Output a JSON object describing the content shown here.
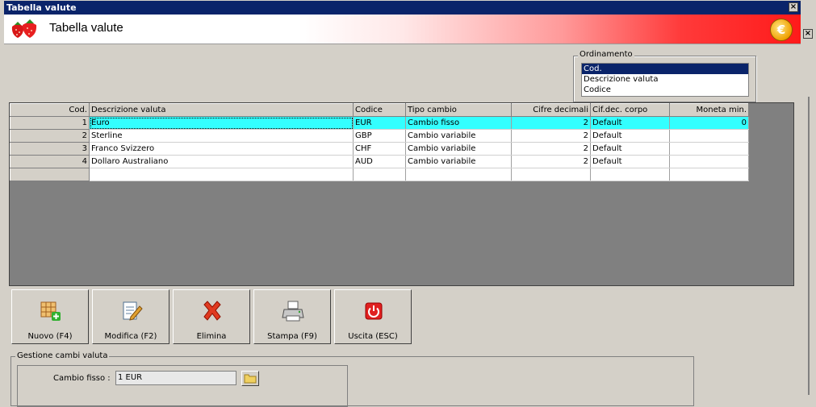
{
  "window": {
    "title": "Tabella valute",
    "close_symbol": "×"
  },
  "banner": {
    "title": "Tabella valute",
    "coin_symbol": "€"
  },
  "ordinamento": {
    "legend": "Ordinamento",
    "items": [
      "Cod.",
      "Descrizione valuta",
      "Codice"
    ],
    "selected_index": 0
  },
  "grid": {
    "columns": [
      "Cod.",
      "Descrizione valuta",
      "Codice",
      "Tipo cambio",
      "Cifre decimali",
      "Cif.dec. corpo",
      "Moneta min."
    ],
    "rows": [
      {
        "cod": "1",
        "desc": "Euro",
        "codice": "EUR",
        "tipo": "Cambio fisso",
        "cifre": "2",
        "corpo": "Default",
        "moneta": "0"
      },
      {
        "cod": "2",
        "desc": "Sterline",
        "codice": "GBP",
        "tipo": "Cambio variabile",
        "cifre": "2",
        "corpo": "Default",
        "moneta": ""
      },
      {
        "cod": "3",
        "desc": "Franco Svizzero",
        "codice": "CHF",
        "tipo": "Cambio variabile",
        "cifre": "2",
        "corpo": "Default",
        "moneta": ""
      },
      {
        "cod": "4",
        "desc": "Dollaro Australiano",
        "codice": "AUD",
        "tipo": "Cambio variabile",
        "cifre": "2",
        "corpo": "Default",
        "moneta": ""
      }
    ]
  },
  "toolbar": {
    "nuovo": "Nuovo (F4)",
    "modifica": "Modifica (F2)",
    "elimina": "Elimina",
    "stampa": "Stampa (F9)",
    "uscita": "Uscita (ESC)"
  },
  "gestione": {
    "legend": "Gestione cambi valuta",
    "cambio_label": "Cambio fisso :",
    "cambio_value": "1 EUR"
  },
  "colors": {
    "title_bar": "#0a246a",
    "selected_row": "#33ffff",
    "banner_red": "#ff1a1a"
  }
}
